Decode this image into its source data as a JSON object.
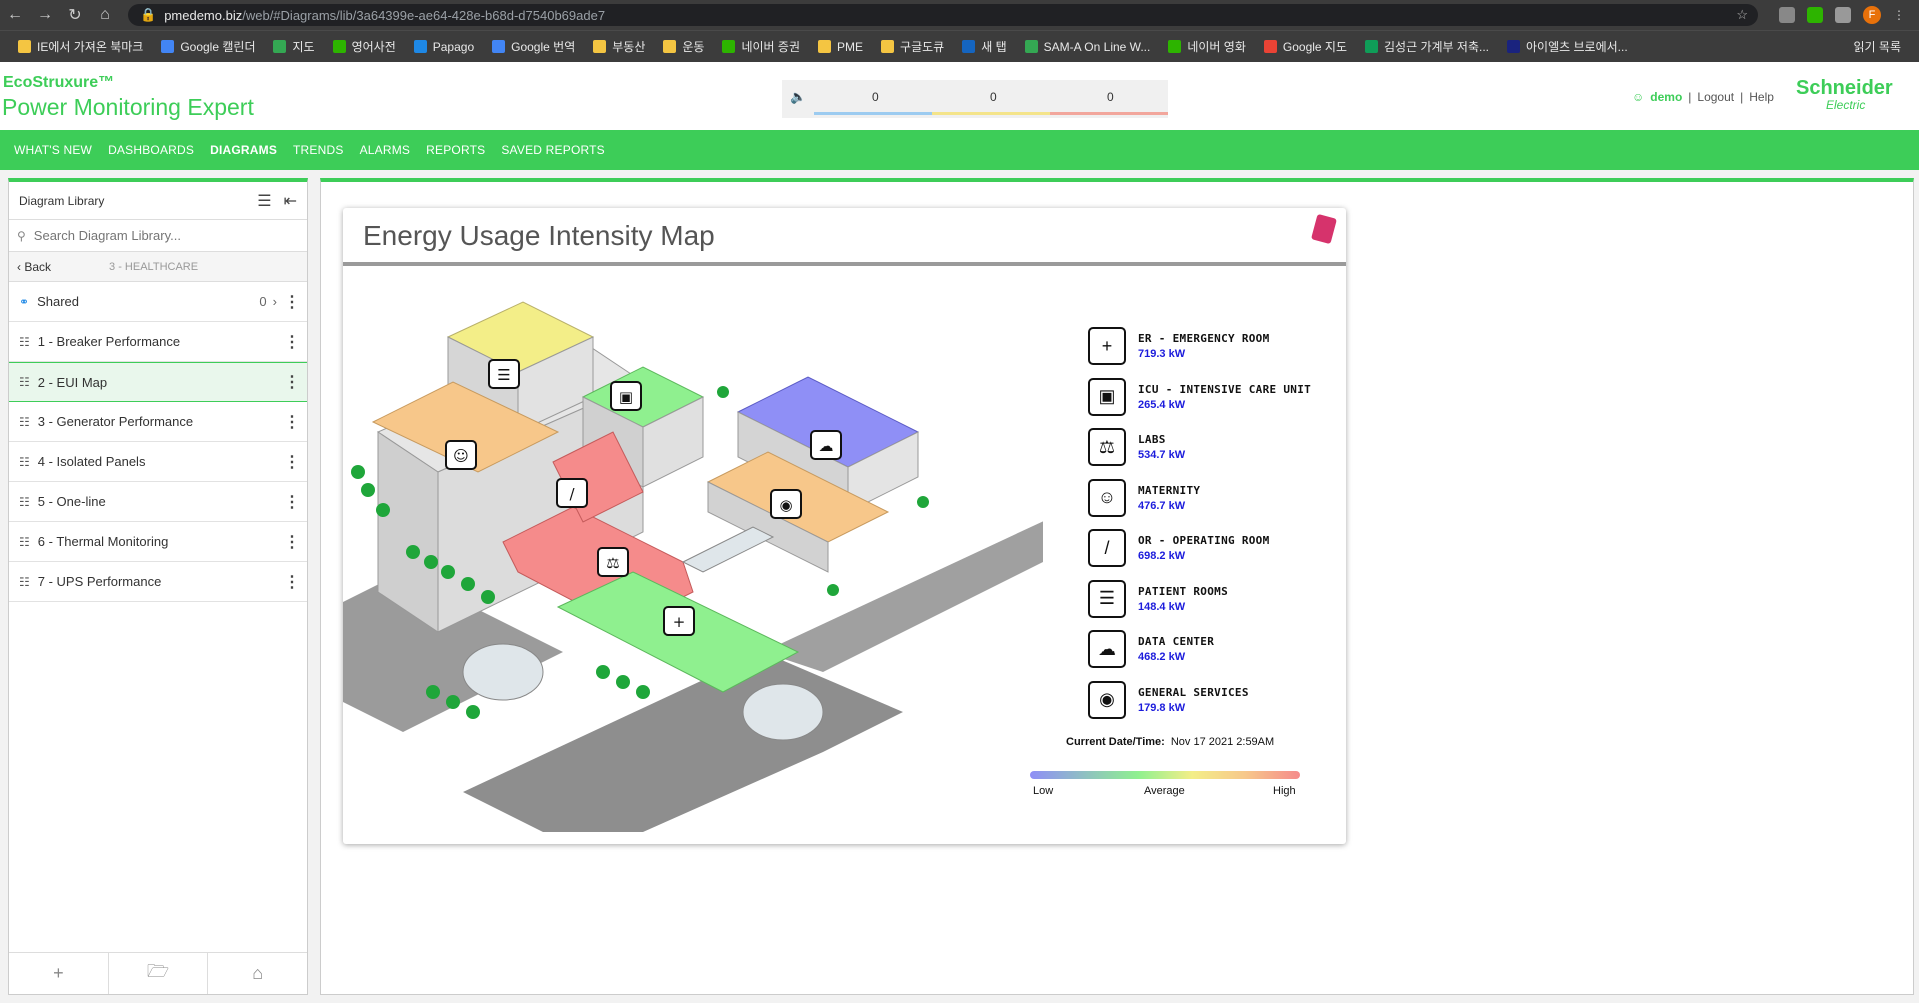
{
  "browser": {
    "url_host": "pmedemo.biz",
    "url_path": "/web/#Diagrams/lib/3a64399e-ae64-428e-b68d-d7540b69ade7",
    "profile_initial": "F",
    "bookmarks": [
      "IE에서 가져온 북마크",
      "Google 캘린더",
      "지도",
      "영어사전",
      "Papago",
      "Google 번역",
      "부동산",
      "운동",
      "네이버 증권",
      "PME",
      "구글도큐",
      "새 탭",
      "SAM-A On Line W...",
      "네이버 영화",
      "Google 지도",
      "김성근 가계부 저축...",
      "아이엘츠 브로에서..."
    ],
    "reading_list": "읽기 목록"
  },
  "header": {
    "brand_small": "EcoStruxure™",
    "brand_large": "Power Monitoring Expert",
    "alarm_counts": [
      "0",
      "0",
      "0"
    ],
    "user": "demo",
    "logout": "Logout",
    "help": "Help",
    "vendor": "Schneider",
    "vendor_sub": "Electric"
  },
  "nav": {
    "items": [
      "WHAT'S NEW",
      "DASHBOARDS",
      "DIAGRAMS",
      "TRENDS",
      "ALARMS",
      "REPORTS",
      "SAVED REPORTS"
    ],
    "active": "DIAGRAMS"
  },
  "sidebar": {
    "title": "Diagram Library",
    "search_placeholder": "Search Diagram Library...",
    "back": "Back",
    "group": "3 - HEALTHCARE",
    "shared": {
      "label": "Shared",
      "count": "0"
    },
    "items": [
      "1 - Breaker Performance",
      "2 - EUI Map",
      "3 - Generator Performance",
      "4 - Isolated Panels",
      "5 - One-line",
      "6 - Thermal Monitoring",
      "7 - UPS Performance"
    ],
    "selected": "2 - EUI Map"
  },
  "diagram": {
    "title": "Energy Usage Intensity Map",
    "legend": [
      {
        "name": "ER - EMERGENCY ROOM",
        "value": "719.3 kW",
        "icon": "ambulance-icon"
      },
      {
        "name": "ICU - INTENSIVE CARE UNIT",
        "value": "265.4 kW",
        "icon": "monitor-icon"
      },
      {
        "name": "LABS",
        "value": "534.7 kW",
        "icon": "microscope-icon"
      },
      {
        "name": "MATERNITY",
        "value": "476.7 kW",
        "icon": "baby-icon"
      },
      {
        "name": "OR - OPERATING ROOM",
        "value": "698.2 kW",
        "icon": "scalpel-icon"
      },
      {
        "name": "PATIENT ROOMS",
        "value": "148.4 kW",
        "icon": "bed-icon"
      },
      {
        "name": "DATA CENTER",
        "value": "468.2 kW",
        "icon": "cloud-server-icon"
      },
      {
        "name": "GENERAL SERVICES",
        "value": "179.8 kW",
        "icon": "food-tray-icon"
      }
    ],
    "datetime_label": "Current Date/Time:",
    "datetime_value": "Nov 17 2021 2:59AM",
    "scale": {
      "low": "Low",
      "average": "Average",
      "high": "High"
    },
    "zone_colors": {
      "low": "#8f8ff6",
      "average": "#8ff08f",
      "mid": "#f3ee88",
      "elevated": "#f7c78a",
      "high": "#f58b8b"
    }
  }
}
